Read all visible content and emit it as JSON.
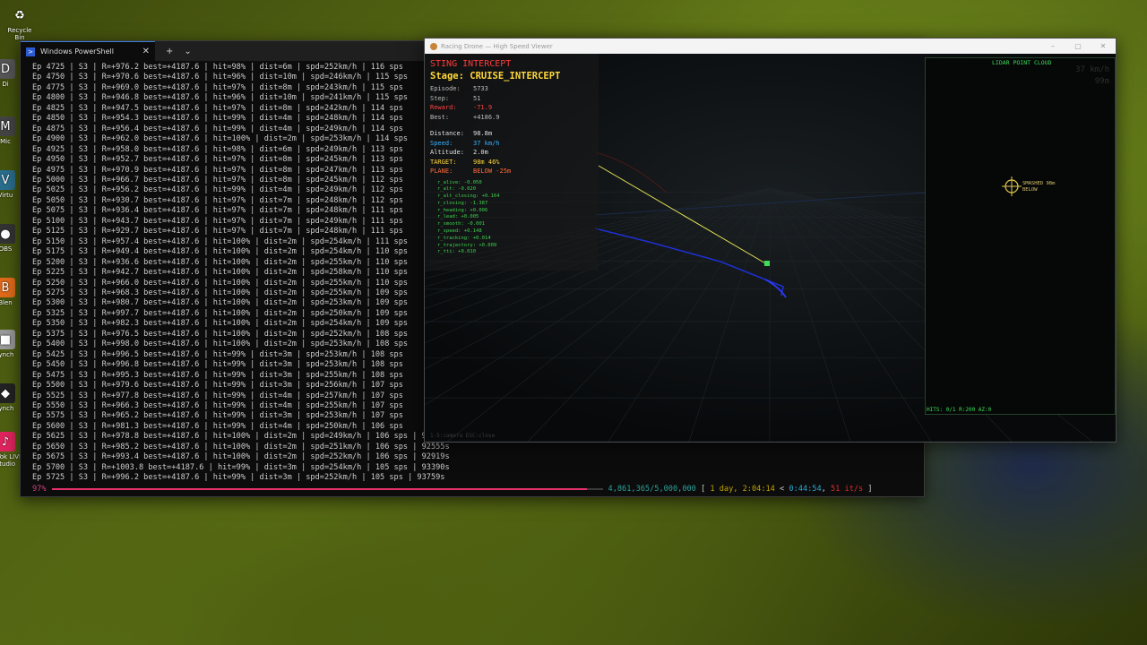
{
  "desktop": {
    "icons": [
      {
        "label": "Recycle Bin",
        "glyph": "♻"
      },
      {
        "label": "Di",
        "glyph": "D"
      },
      {
        "label": "Mic",
        "glyph": "M"
      },
      {
        "label": "Virtu",
        "glyph": "V"
      },
      {
        "label": "OBS",
        "glyph": "●"
      },
      {
        "label": "Blen",
        "glyph": "B"
      },
      {
        "label": "lynch",
        "glyph": "■"
      },
      {
        "label": "lynch",
        "glyph": "◆"
      },
      {
        "label": "TikTok LIVE Studio",
        "glyph": "♪"
      }
    ]
  },
  "powershell": {
    "tab_title": "Windows PowerShell",
    "close_glyph": "✕",
    "new_tab_glyph": "+",
    "dropdown_glyph": "⌄",
    "log_lines": [
      "Ep 4725 | S3 | R=+976.2 best=+4187.6 | hit=98% | dist=6m | spd=252km/h | 116 sps",
      "Ep 4750 | S3 | R=+970.6 best=+4187.6 | hit=96% | dist=10m | spd=246km/h | 115 sps",
      "Ep 4775 | S3 | R=+969.0 best=+4187.6 | hit=97% | dist=8m | spd=243km/h | 115 sps",
      "Ep 4800 | S3 | R=+946.8 best=+4187.6 | hit=96% | dist=10m | spd=241km/h | 115 sps",
      "Ep 4825 | S3 | R=+947.5 best=+4187.6 | hit=97% | dist=8m | spd=242km/h | 114 sps",
      "Ep 4850 | S3 | R=+954.3 best=+4187.6 | hit=99% | dist=4m | spd=248km/h | 114 sps",
      "Ep 4875 | S3 | R=+956.4 best=+4187.6 | hit=99% | dist=4m | spd=249km/h | 114 sps",
      "Ep 4900 | S3 | R=+962.0 best=+4187.6 | hit=100% | dist=2m | spd=253km/h | 114 sps",
      "Ep 4925 | S3 | R=+958.0 best=+4187.6 | hit=98% | dist=6m | spd=249km/h | 113 sps",
      "Ep 4950 | S3 | R=+952.7 best=+4187.6 | hit=97% | dist=8m | spd=245km/h | 113 sps",
      "Ep 4975 | S3 | R=+970.9 best=+4187.6 | hit=97% | dist=8m | spd=247km/h | 113 sps",
      "Ep 5000 | S3 | R=+966.7 best=+4187.6 | hit=97% | dist=8m | spd=245km/h | 112 sps",
      "Ep 5025 | S3 | R=+956.2 best=+4187.6 | hit=99% | dist=4m | spd=249km/h | 112 sps",
      "Ep 5050 | S3 | R=+930.7 best=+4187.6 | hit=97% | dist=7m | spd=248km/h | 112 sps",
      "Ep 5075 | S3 | R=+936.4 best=+4187.6 | hit=97% | dist=7m | spd=248km/h | 111 sps",
      "Ep 5100 | S3 | R=+943.7 best=+4187.6 | hit=97% | dist=7m | spd=249km/h | 111 sps",
      "Ep 5125 | S3 | R=+929.7 best=+4187.6 | hit=97% | dist=7m | spd=248km/h | 111 sps",
      "Ep 5150 | S3 | R=+957.4 best=+4187.6 | hit=100% | dist=2m | spd=254km/h | 111 sps",
      "Ep 5175 | S3 | R=+949.4 best=+4187.6 | hit=100% | dist=2m | spd=254km/h | 110 sps",
      "Ep 5200 | S3 | R=+936.6 best=+4187.6 | hit=100% | dist=2m | spd=255km/h | 110 sps",
      "Ep 5225 | S3 | R=+942.7 best=+4187.6 | hit=100% | dist=2m | spd=258km/h | 110 sps",
      "Ep 5250 | S3 | R=+966.0 best=+4187.6 | hit=100% | dist=2m | spd=255km/h | 110 sps",
      "Ep 5275 | S3 | R=+968.3 best=+4187.6 | hit=100% | dist=2m | spd=255km/h | 109 sps",
      "Ep 5300 | S3 | R=+980.7 best=+4187.6 | hit=100% | dist=2m | spd=253km/h | 109 sps",
      "Ep 5325 | S3 | R=+997.7 best=+4187.6 | hit=100% | dist=2m | spd=250km/h | 109 sps",
      "Ep 5350 | S3 | R=+982.3 best=+4187.6 | hit=100% | dist=2m | spd=254km/h | 109 sps",
      "Ep 5375 | S3 | R=+976.5 best=+4187.6 | hit=100% | dist=2m | spd=252km/h | 108 sps",
      "Ep 5400 | S3 | R=+998.0 best=+4187.6 | hit=100% | dist=2m | spd=253km/h | 108 sps",
      "Ep 5425 | S3 | R=+996.5 best=+4187.6 | hit=99% | dist=3m | spd=253km/h | 108 sps",
      "Ep 5450 | S3 | R=+996.8 best=+4187.6 | hit=99% | dist=3m | spd=253km/h | 108 sps",
      "Ep 5475 | S3 | R=+995.3 best=+4187.6 | hit=99% | dist=3m | spd=255km/h | 108 sps",
      "Ep 5500 | S3 | R=+979.6 best=+4187.6 | hit=99% | dist=3m | spd=256km/h | 107 sps",
      "Ep 5525 | S3 | R=+977.8 best=+4187.6 | hit=99% | dist=4m | spd=257km/h | 107 sps",
      "Ep 5550 | S3 | R=+966.3 best=+4187.6 | hit=99% | dist=4m | spd=255km/h | 107 sps",
      "Ep 5575 | S3 | R=+965.2 best=+4187.6 | hit=99% | dist=3m | spd=253km/h | 107 sps",
      "Ep 5600 | S3 | R=+981.3 best=+4187.6 | hit=99% | dist=4m | spd=250km/h | 106 sps",
      "Ep 5625 | S3 | R=+978.8 best=+4187.6 | hit=100% | dist=2m | spd=249km/h | 106 sps | 92185s",
      "Ep 5650 | S3 | R=+985.2 best=+4187.6 | hit=100% | dist=2m | spd=251km/h | 106 sps | 92555s",
      "Ep 5675 | S3 | R=+993.4 best=+4187.6 | hit=100% | dist=2m | spd=252km/h | 106 sps | 92919s",
      "Ep 5700 | S3 | R=+1003.8 best=+4187.6 | hit=99% | dist=3m | spd=254km/h | 105 sps | 93390s",
      "Ep 5725 | S3 | R=+996.2 best=+4187.6 | hit=99% | dist=3m | spd=252km/h | 105 sps | 93759s"
    ],
    "progress": {
      "percent_label": "97%",
      "fraction": 0.9723,
      "count": "4,861,365/5,000,000",
      "open": "[",
      "elapsed": "1 day, 2:04:14",
      "sep": "<",
      "remaining": "0:44:54",
      "comma": ",",
      "rate": "51 it/s",
      "close": "]",
      "bar_color": "#e5326b"
    }
  },
  "viewer": {
    "title": "Racing Drone — High Speed Viewer",
    "minimize_glyph": "–",
    "maximize_glyph": "▢",
    "close_glyph": "✕",
    "hud": {
      "mode": "STING INTERCEPT",
      "stage": "Stage: CRUISE_INTERCEPT",
      "rows1": [
        {
          "k": "Episode:",
          "v": "5733",
          "color": "#bbbbbb"
        },
        {
          "k": "Step:",
          "v": "51",
          "color": "#bbbbbb"
        },
        {
          "k": "Reward:",
          "v": "-71.9",
          "color": "#ff4444"
        },
        {
          "k": "Best:",
          "v": "+4186.9",
          "color": "#bbbbbb"
        }
      ],
      "rows2": [
        {
          "k": "Distance:",
          "v": "98.8m",
          "color": "#e0e0e0"
        },
        {
          "k": "Speed:",
          "v": "37 km/h",
          "color": "#39b0ff"
        },
        {
          "k": "Altitude:",
          "v": "2.0m",
          "color": "#e0e0e0"
        },
        {
          "k": "TARGET:",
          "v": "98m 46%",
          "color": "#ffd83a"
        },
        {
          "k": "PLANE:",
          "v": "BELOW -25m",
          "color": "#ff6a3a"
        }
      ],
      "reward_terms": [
        "r_alive: -0.050",
        "r_alt: -0.020",
        "r_alt_closing: +0.164",
        "r_closing: -1.387",
        "r_heading: +0.006",
        "r_lead: +0.005",
        "r_smooth: -0.001",
        "r_speed: +0.148",
        "r_tracking: +0.014",
        "r_trajectory: +0.009",
        "r_tti: +0.010"
      ]
    },
    "lidar": {
      "title": "LIDAR POINT CLOUD",
      "speed_ghost": "37 km/h",
      "alt_ghost": "99m",
      "target_label_1": "SMASHED 98m",
      "target_label_2": "BELOW",
      "footer": "HITS: 0/1  R:200  AZ:0"
    },
    "hint": "1-5:camera  ESC:close"
  }
}
